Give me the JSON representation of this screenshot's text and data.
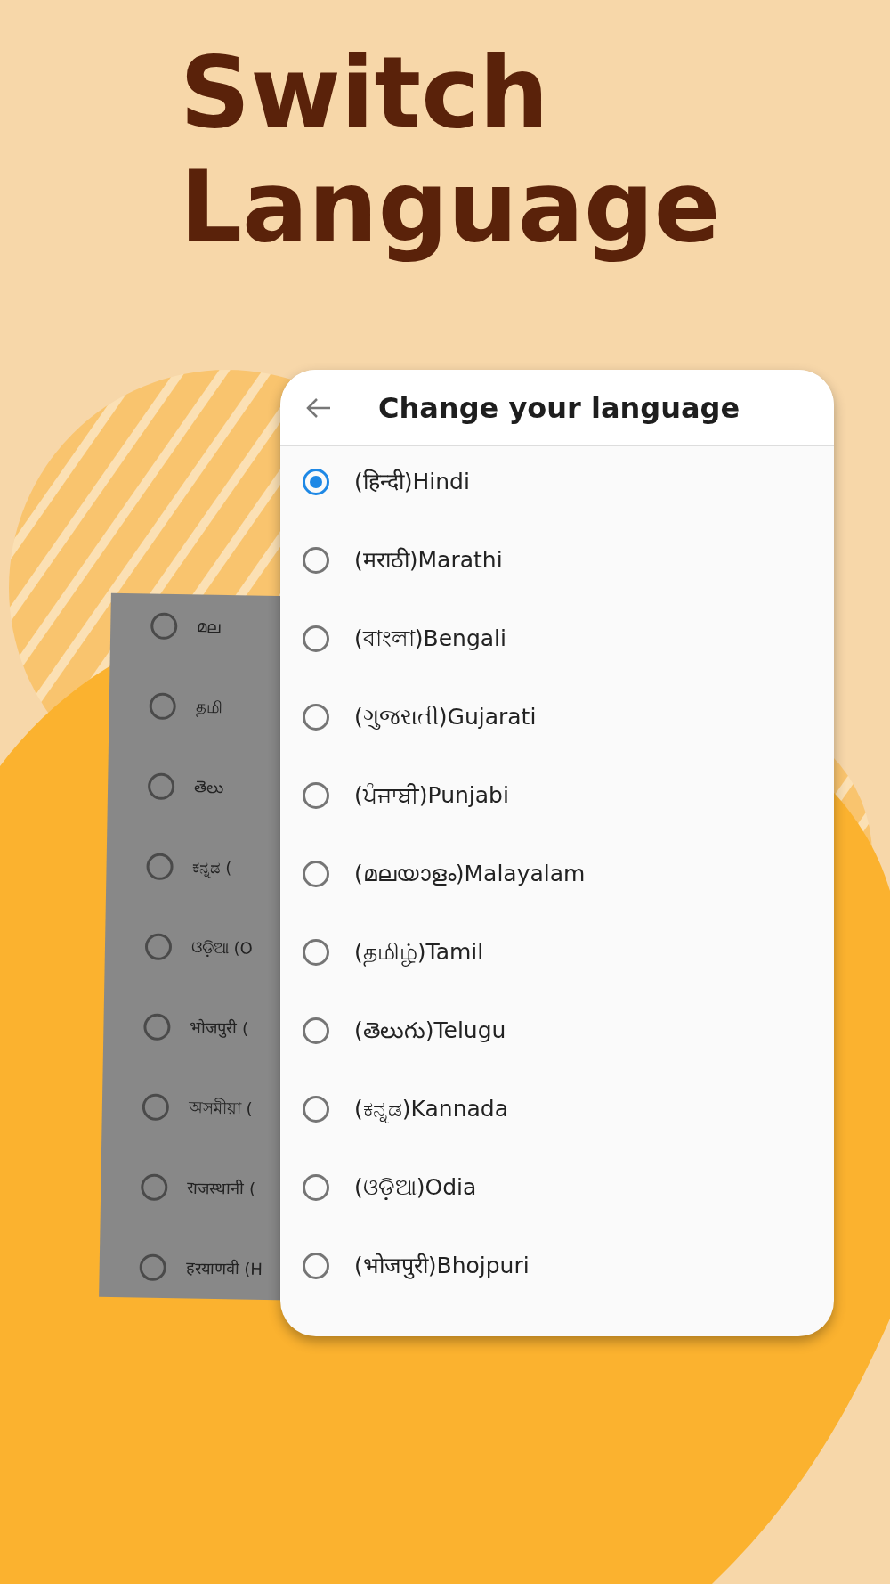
{
  "headline": [
    "Switch",
    "Language"
  ],
  "back_list": [
    {
      "label": "മല",
      "selected": false
    },
    {
      "label": "தமி",
      "selected": false
    },
    {
      "label": "తెలు",
      "selected": false
    },
    {
      "label": "ಕನ್ನಡ (",
      "selected": false
    },
    {
      "label": "ଓଡ଼ିଆ (O",
      "selected": false
    },
    {
      "label": "भोजपुरी (",
      "selected": false
    },
    {
      "label": "অসমীয়া (",
      "selected": false
    },
    {
      "label": "राजस्थानी (",
      "selected": false
    },
    {
      "label": "हरयाणवी (H",
      "selected": false
    }
  ],
  "screen": {
    "title": "Change your language",
    "languages": [
      {
        "label": "(हिन्दी)Hindi",
        "selected": true
      },
      {
        "label": "(मराठी)Marathi",
        "selected": false
      },
      {
        "label": "(বাংলা)Bengali",
        "selected": false
      },
      {
        "label": "(ગુજરાતી)Gujarati",
        "selected": false
      },
      {
        "label": "(ਪੰਜਾਬੀ)Punjabi",
        "selected": false
      },
      {
        "label": "(മലയാളം)Malayalam",
        "selected": false
      },
      {
        "label": "(தமிழ்)Tamil",
        "selected": false
      },
      {
        "label": "(తెలుగు)Telugu",
        "selected": false
      },
      {
        "label": "(ಕನ್ನಡ)Kannada",
        "selected": false
      },
      {
        "label": "(ଓଡ଼ିଆ)Odia",
        "selected": false
      },
      {
        "label": "(भोजपुरी)Bhojpuri",
        "selected": false
      }
    ]
  }
}
